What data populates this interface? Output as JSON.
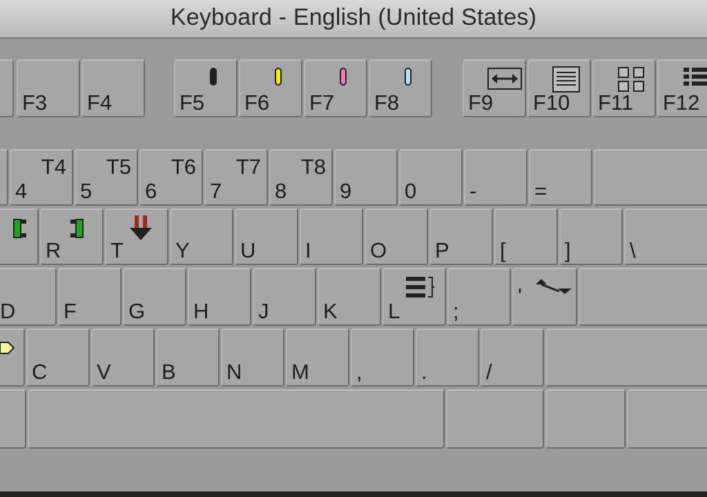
{
  "window": {
    "title": "Keyboard - English (United States)"
  },
  "function_row": {
    "f3": "F3",
    "f4": "F4",
    "f5": "F5",
    "f6": "F6",
    "f7": "F7",
    "f8": "F8",
    "f9": "F9",
    "f10": "F10",
    "f11": "F11",
    "f12": "F12",
    "marker_colors": {
      "f5": "#222222",
      "f6": "#f2f200",
      "f7": "#f078b4",
      "f8": "#a8eef8"
    }
  },
  "number_row": {
    "k4": "4",
    "t4": "T4",
    "k5": "5",
    "t5": "T5",
    "k6": "6",
    "t6": "T6",
    "k7": "7",
    "t7": "T7",
    "k8": "8",
    "t8": "T8",
    "k9": "9",
    "k0": "0",
    "minus": "-",
    "equals": "="
  },
  "top_row": {
    "r": "R",
    "t": "T",
    "y": "Y",
    "u": "U",
    "i": "I",
    "o": "O",
    "p": "P",
    "lbracket": "[",
    "rbracket": "]",
    "backslash": "\\"
  },
  "home_row": {
    "d": "D",
    "f": "F",
    "g": "G",
    "h": "H",
    "j": "J",
    "k": "K",
    "l": "L",
    "semicolon": ";",
    "quote": "'"
  },
  "bottom_row": {
    "c": "C",
    "v": "V",
    "b": "B",
    "n": "N",
    "m": "M",
    "comma": ",",
    "period": ".",
    "slash": "/"
  },
  "icons": {
    "f5": "black-marker-icon",
    "f6": "yellow-marker-icon",
    "f7": "pink-marker-icon",
    "f8": "cyan-marker-icon",
    "f9": "fit-width-icon",
    "f10": "list-view-icon",
    "f11": "grid-view-icon",
    "f12": "list-grid-icon",
    "e": "mark-in-icon",
    "r": "mark-out-icon",
    "t": "lift-icon",
    "l": "clip-list-icon",
    "quote": "transition-icon",
    "x": "pointer-hand-icon"
  }
}
